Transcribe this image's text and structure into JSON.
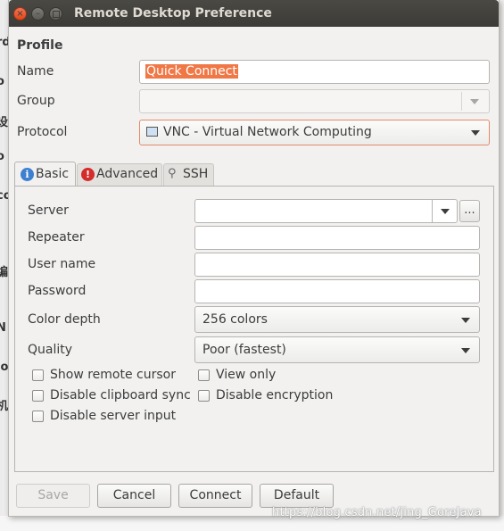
{
  "window": {
    "title": "Remote Desktop Preference"
  },
  "profile": {
    "heading": "Profile",
    "name_label": "Name",
    "name_value": "Quick Connect",
    "group_label": "Group",
    "group_value": "",
    "protocol_label": "Protocol",
    "protocol_value": "VNC - Virtual Network Computing"
  },
  "tabs": [
    {
      "label": "Basic",
      "icon": "info-icon",
      "active": true
    },
    {
      "label": "Advanced",
      "icon": "warning-icon",
      "active": false
    },
    {
      "label": "SSH",
      "icon": "ssh-icon",
      "active": false
    }
  ],
  "basic": {
    "server_label": "Server",
    "server_value": "",
    "browse_label": "...",
    "repeater_label": "Repeater",
    "username_label": "User name",
    "password_label": "Password",
    "color_depth_label": "Color depth",
    "color_depth_value": "256 colors",
    "quality_label": "Quality",
    "quality_value": "Poor (fastest)"
  },
  "checkboxes": [
    {
      "label": "Show remote cursor",
      "checked": false
    },
    {
      "label": "View only",
      "checked": false
    },
    {
      "label": "Disable clipboard sync",
      "checked": false
    },
    {
      "label": "Disable encryption",
      "checked": false
    },
    {
      "label": "Disable server input",
      "checked": false
    }
  ],
  "buttons": {
    "save": "Save",
    "cancel": "Cancel",
    "connect": "Connect",
    "default": "Default"
  },
  "background": {
    "left_chars": [
      "rd",
      "o",
      "设",
      "o",
      "co",
      "编",
      "N",
      "lo",
      "机"
    ],
    "watermark": "https://blog.csdn.net/jing_GoreJava"
  },
  "colors": {
    "selection": "#f07746",
    "titlebar": "#3c3b37",
    "close_button": "#de4815"
  }
}
